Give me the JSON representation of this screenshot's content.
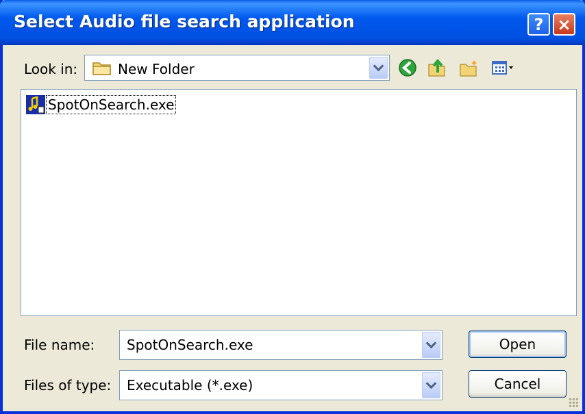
{
  "window": {
    "title": "Select Audio file search application"
  },
  "titlebar_buttons": {
    "help": "?",
    "close": "×"
  },
  "look_in": {
    "label": "Look in:",
    "value": "New Folder"
  },
  "toolbar": {
    "icons": [
      "back-icon",
      "up-folder-icon",
      "new-folder-icon",
      "view-menu-icon"
    ]
  },
  "files": [
    {
      "name": "SpotOnSearch.exe",
      "icon": "audio-exe-icon"
    }
  ],
  "file_name": {
    "label": "File name:",
    "value": "SpotOnSearch.exe"
  },
  "file_type": {
    "label": "Files of type:",
    "value": "Executable (*.exe)"
  },
  "buttons": {
    "open": "Open",
    "cancel": "Cancel"
  },
  "colors": {
    "titlebar": "#0058EE",
    "dialog_bg": "#ECE9D8",
    "close": "#C8381C"
  }
}
